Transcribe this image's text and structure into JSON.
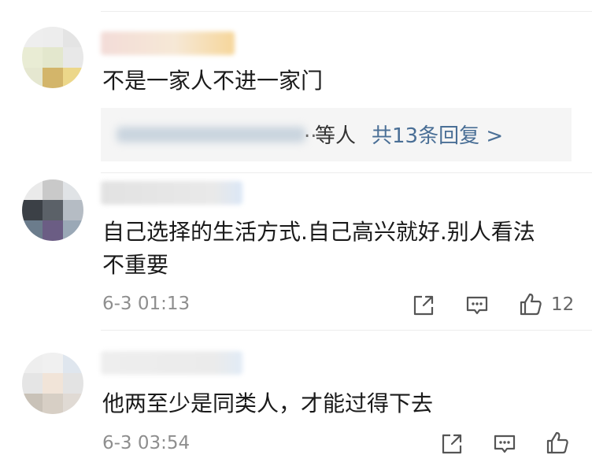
{
  "comments": [
    {
      "text": "不是一家人不进一家门",
      "reply_summary": {
        "ellipsis": "..",
        "others": "等人",
        "count_link": "共13条回复 >"
      }
    },
    {
      "text_line1": "自己选择的生活方式.自己高兴就好.别人看法",
      "text_line2": "不重要",
      "timestamp": "6-3 01:13",
      "likes": "12"
    },
    {
      "text": "他两至少是同类人，才能过得下去",
      "timestamp": "6-3 03:54"
    }
  ],
  "icons": [
    "share-icon",
    "reply-icon",
    "like-icon"
  ],
  "colors": {
    "link": "#4a6f96",
    "meta": "#8e8e8e",
    "reply_bg": "#f5f5f5",
    "icon": "#555555"
  }
}
